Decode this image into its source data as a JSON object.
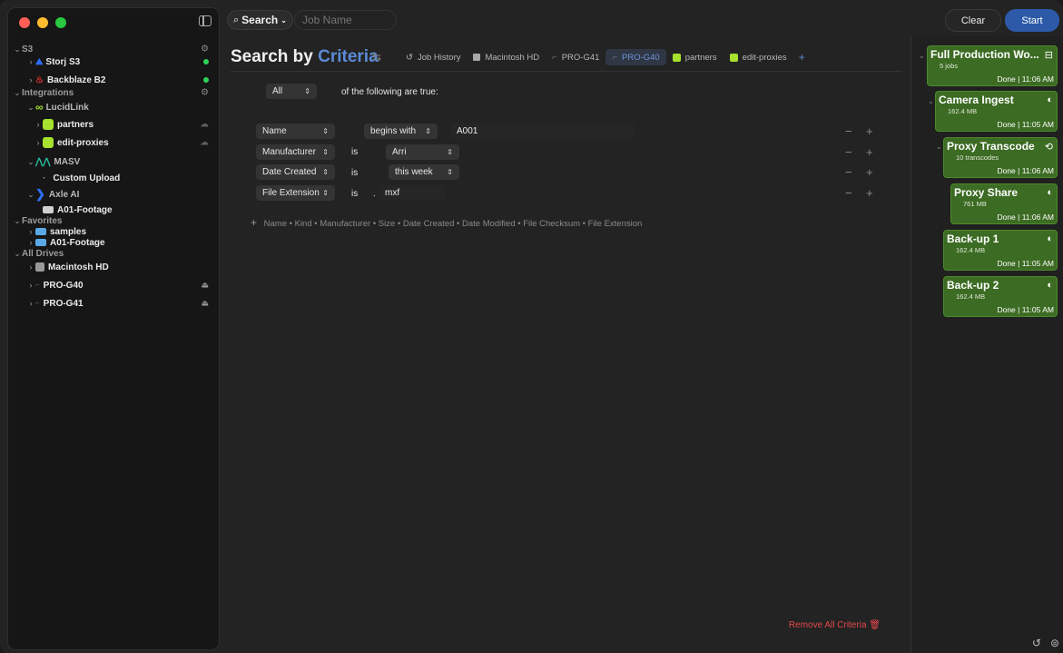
{
  "sidebar": {
    "sections": {
      "s3": "S3",
      "integrations": "Integrations",
      "favorites": "Favorites",
      "all_drives": "All Drives"
    },
    "items": {
      "storj": "Storj S3",
      "backblaze": "Backblaze B2",
      "lucidlink": "LucidLink",
      "partners": "partners",
      "edit_proxies": "edit-proxies",
      "masv": "MASV",
      "custom_upload": "Custom Upload",
      "axle": "Axle AI",
      "a01_footage_axle": "A01-Footage",
      "samples": "samples",
      "a01_footage_fav": "A01-Footage",
      "macintosh_hd": "Macintosh HD",
      "pro_g40": "PRO-G40",
      "pro_g41": "PRO-G41"
    }
  },
  "topbar": {
    "search_label": "Search",
    "job_name_placeholder": "Job Name",
    "clear_label": "Clear",
    "start_label": "Start"
  },
  "main": {
    "title_a": "Search by",
    "title_b": "Criteria",
    "tabs": {
      "job_history": "Job History",
      "macintosh_hd": "Macintosh HD",
      "pro_g41": "PRO-G41",
      "pro_g40": "PRO-G40",
      "partners": "partners",
      "edit_proxies": "edit-proxies"
    },
    "match_mode": "All",
    "match_text": "of the following are true:",
    "criteria": [
      {
        "field": "Name",
        "op": "begins with",
        "value": "A001"
      },
      {
        "field": "Manufacturer",
        "op": "is",
        "value": "Arri"
      },
      {
        "field": "Date Created",
        "op": "is",
        "value": "this week"
      },
      {
        "field": "File Extension",
        "op": "is",
        "dot": ".",
        "value": "mxf"
      }
    ],
    "add_criteria": "Name • Kind • Manufacturer • Size • Date Created • Date Modified • File Checksum • File Extension",
    "remove_all": "Remove All Criteria"
  },
  "jobs": [
    {
      "title": "Full Production Wo...",
      "sub": "5 jobs",
      "status": "Done | 11:06 AM"
    },
    {
      "title": "Camera Ingest",
      "sub": "162.4 MB",
      "status": "Done | 11:05 AM"
    },
    {
      "title": "Proxy Transcode",
      "sub": "10 transcodes",
      "status": "Done | 11:06 AM"
    },
    {
      "title": "Proxy Share",
      "sub": "761 MB",
      "status": "Done | 11:06 AM"
    },
    {
      "title": "Back-up 1",
      "sub": "162.4 MB",
      "status": "Done | 11:05 AM"
    },
    {
      "title": "Back-up 2",
      "sub": "162.4 MB",
      "status": "Done | 11:05 AM"
    }
  ],
  "colors": {
    "accent": "#5b8bd6",
    "start_button": "#2c5aa8",
    "job_card": "#3c6b23",
    "danger": "#e5484d",
    "status_ok": "#30d158"
  }
}
